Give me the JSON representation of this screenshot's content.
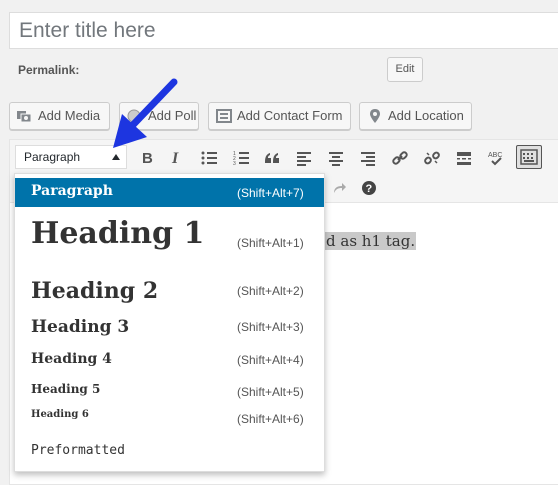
{
  "title_field": {
    "placeholder": "Enter title here"
  },
  "permalink": {
    "label": "Permalink:",
    "edit_label": "Edit"
  },
  "media_buttons": {
    "add_media": "Add Media",
    "add_poll": "Add Poll",
    "add_contact_form": "Add Contact Form",
    "add_location": "Add Location"
  },
  "format_select": {
    "value": "Paragraph"
  },
  "content": {
    "visible_text": "d as h1 tag."
  },
  "dropdown": {
    "items": [
      {
        "label": "Paragraph",
        "shortcut": "(Shift+Alt+7)"
      },
      {
        "label": "Heading 1",
        "shortcut": "(Shift+Alt+1)"
      },
      {
        "label": "Heading 2",
        "shortcut": "(Shift+Alt+2)"
      },
      {
        "label": "Heading 3",
        "shortcut": "(Shift+Alt+3)"
      },
      {
        "label": "Heading 4",
        "shortcut": "(Shift+Alt+4)"
      },
      {
        "label": "Heading 5",
        "shortcut": "(Shift+Alt+5)"
      },
      {
        "label": "Heading 6",
        "shortcut": "(Shift+Alt+6)"
      },
      {
        "label": "Preformatted",
        "shortcut": ""
      }
    ]
  },
  "toolbar": {
    "icons": [
      "bold-icon",
      "italic-icon",
      "bulleted-list-icon",
      "numbered-list-icon",
      "blockquote-icon",
      "align-left-icon",
      "align-center-icon",
      "align-right-icon",
      "insert-link-icon",
      "remove-link-icon",
      "read-more-icon",
      "spellcheck-icon",
      "toolbar-toggle-icon",
      "redo-icon",
      "help-icon"
    ],
    "spellcheck_label": "ABC",
    "help_glyph": "?"
  },
  "colors": {
    "selected_bg": "#0073aa",
    "arrow": "#1d35e0",
    "highlight": "#c9c9c9"
  }
}
